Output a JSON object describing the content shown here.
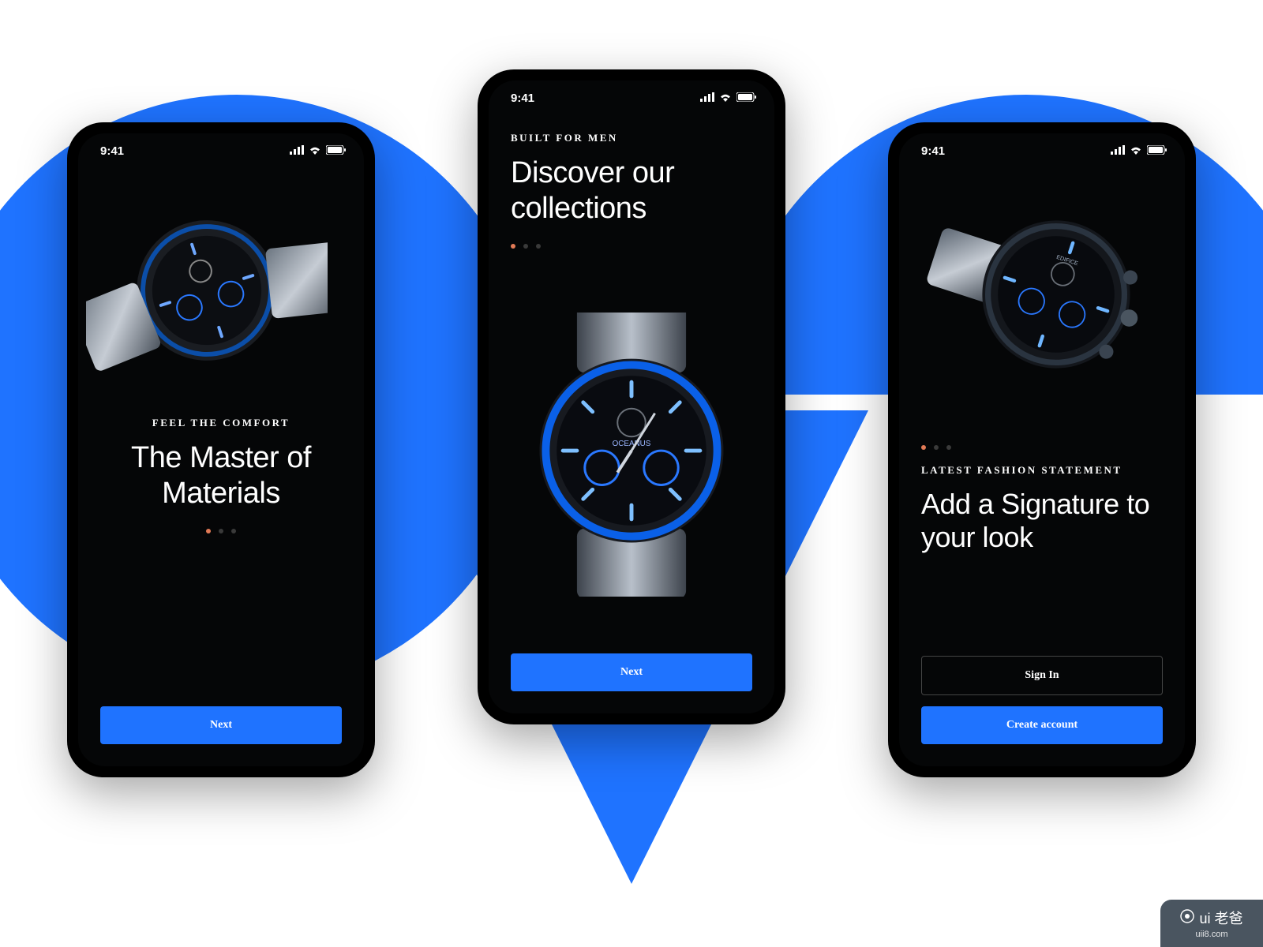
{
  "status": {
    "time": "9:41"
  },
  "colors": {
    "accent": "#1F73FF",
    "dot_active": "#E27A56"
  },
  "screens": {
    "left": {
      "overline": "FEEL THE COMFORT",
      "headline": "The Master of Materials",
      "button_next": "Next",
      "active_dot_index": 0
    },
    "middle": {
      "overline": "BUILT FOR MEN",
      "headline": "Discover our collections",
      "button_next": "Next",
      "active_dot_index": 0
    },
    "right": {
      "overline": "LATEST FASHION STATEMENT",
      "headline": "Add a Signature to your look",
      "button_signin": "Sign In",
      "button_create": "Create account",
      "active_dot_index": 0
    }
  },
  "watermark": {
    "brand": "ui 老爸",
    "url": "uii8.com"
  }
}
